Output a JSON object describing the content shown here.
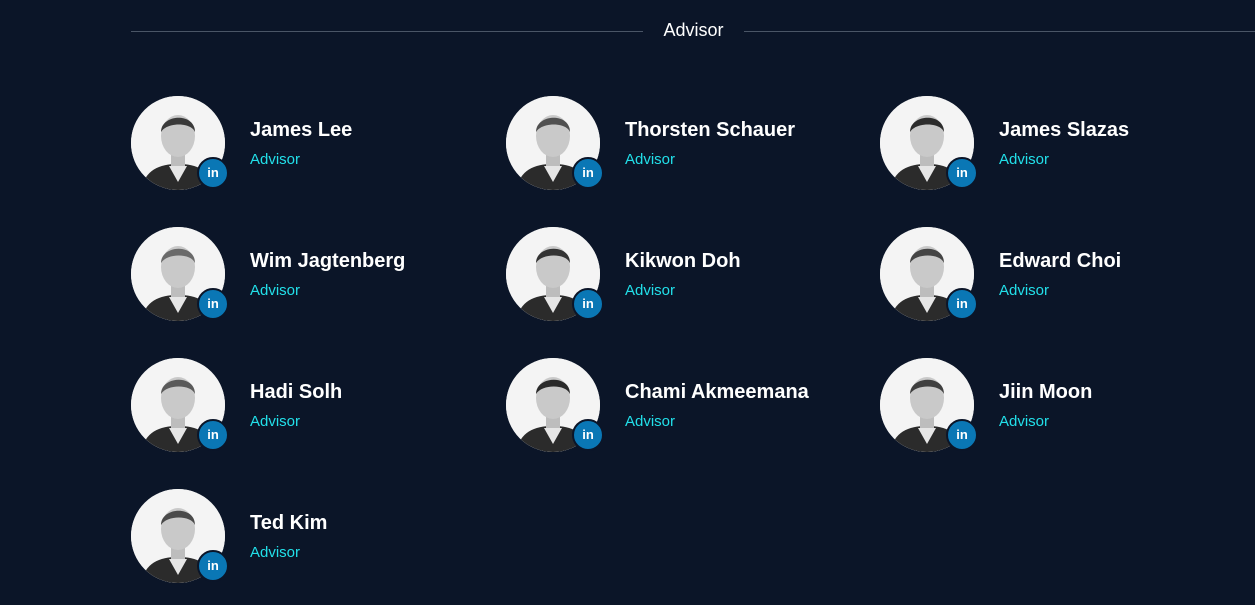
{
  "section": {
    "title": "Advisor"
  },
  "icons": {
    "linkedin_label": "in"
  },
  "colors": {
    "background": "#0b1528",
    "name": "#ffffff",
    "role": "#22e0ea",
    "linkedin": "#0a77b5"
  },
  "advisors": [
    {
      "name": "James Lee",
      "role": "Advisor"
    },
    {
      "name": "Thorsten Schauer",
      "role": "Advisor"
    },
    {
      "name": "James Slazas",
      "role": "Advisor"
    },
    {
      "name": "Wim Jagtenberg",
      "role": "Advisor"
    },
    {
      "name": "Kikwon Doh",
      "role": "Advisor"
    },
    {
      "name": "Edward Choi",
      "role": "Advisor"
    },
    {
      "name": "Hadi Solh",
      "role": "Advisor"
    },
    {
      "name": "Chami Akmeemana",
      "role": "Advisor"
    },
    {
      "name": "Jiin Moon",
      "role": "Advisor"
    },
    {
      "name": "Ted Kim",
      "role": "Advisor"
    }
  ]
}
